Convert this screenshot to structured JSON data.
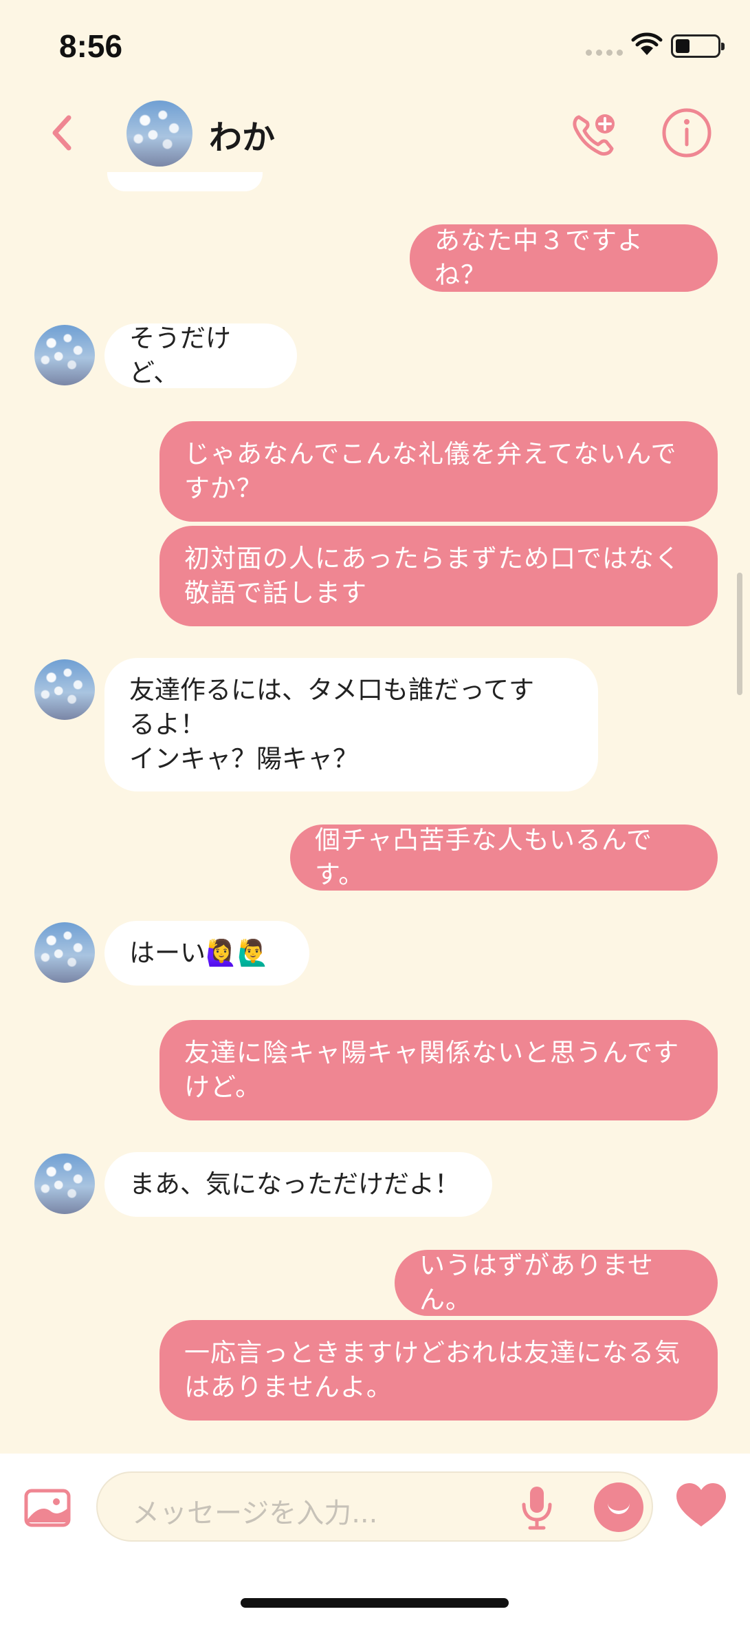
{
  "status": {
    "time": "8:56"
  },
  "header": {
    "contact_name": "わか"
  },
  "messages": [
    {
      "dir": "out",
      "lines": [
        "あなた中３ですよね？"
      ]
    },
    {
      "dir": "in",
      "lines": [
        "そうだけど、"
      ]
    },
    {
      "dir": "out",
      "lines": [
        "じゃあなんでこんな礼儀を弁えてないんで",
        "すか？"
      ]
    },
    {
      "dir": "out",
      "lines": [
        "初対面の人にあったらまずため口ではなく",
        "敬語で話します"
      ]
    },
    {
      "dir": "in",
      "lines": [
        "友達作るには、タメ口も誰だってす",
        "るよ！",
        "インキャ？陽キャ？"
      ]
    },
    {
      "dir": "out",
      "lines": [
        "個チャ凸苦手な人もいるんです。"
      ]
    },
    {
      "dir": "in",
      "lines": [
        "はーい🙋‍♀️🙋‍♂️"
      ]
    },
    {
      "dir": "out",
      "lines": [
        "友達に陰キャ陽キャ関係ないと思うんです",
        "けど。"
      ]
    },
    {
      "dir": "in",
      "lines": [
        "まあ、気になっただけだよ！"
      ]
    },
    {
      "dir": "out",
      "lines": [
        "いうはずがありません。"
      ]
    },
    {
      "dir": "out",
      "lines": [
        "一応言っときますけどおれは友達になる気",
        "はありませんよ。"
      ]
    }
  ],
  "input": {
    "placeholder": "メッセージを入力..."
  },
  "icons": {
    "back": "chevron-left-icon",
    "call": "phone-add-icon",
    "info": "info-icon",
    "image": "image-icon",
    "mic": "microphone-icon",
    "emoji": "smile-icon",
    "like": "heart-icon"
  },
  "colors": {
    "accent": "#ef8692",
    "background": "#fdf6e4",
    "incoming_bubble": "#ffffff"
  }
}
